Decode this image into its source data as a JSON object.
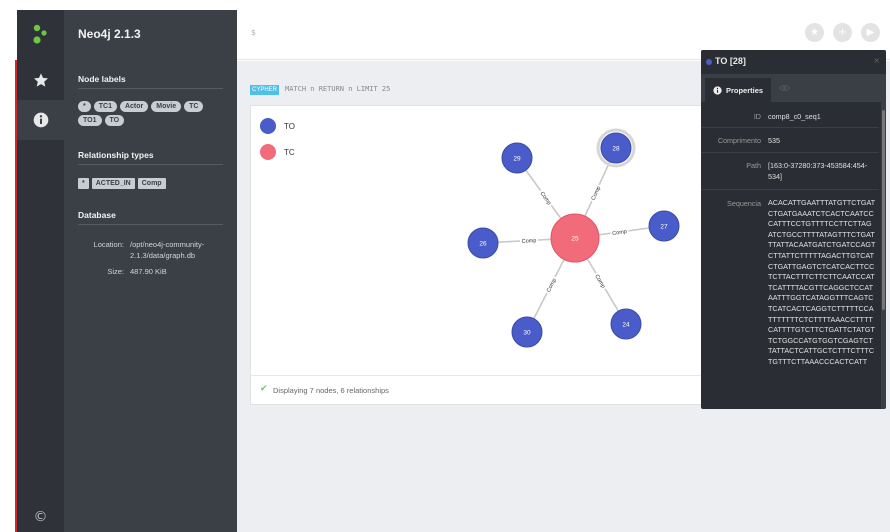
{
  "app": {
    "title": "Neo4j 2.1.3"
  },
  "topbar": {
    "prompt": "$"
  },
  "drawer": {
    "node_labels_heading": "Node labels",
    "node_labels": [
      "*",
      "TC1",
      "Actor",
      "Movie",
      "TC",
      "TO1",
      "TO"
    ],
    "rel_types_heading": "Relationship types",
    "rel_types": [
      "*",
      "ACTED_IN",
      "Comp"
    ],
    "database_heading": "Database",
    "location_label": "Location:",
    "location_value": "/opt/neo4j-community-2.1.3/data/graph.db",
    "size_label": "Size:",
    "size_value": "487.90 KiB"
  },
  "query": {
    "badge": "CYPHER",
    "text": "MATCH n RETURN n LIMIT 25"
  },
  "legend": [
    {
      "label": "TO",
      "color": "#4a5cc9"
    },
    {
      "label": "TC",
      "color": "#f26b7a"
    }
  ],
  "graph": {
    "rel_label": "Comp",
    "center": {
      "id": "25",
      "color": "#f26b7a"
    },
    "nodes": [
      {
        "id": "29",
        "color": "#4a5cc9"
      },
      {
        "id": "28",
        "color": "#4a5cc9"
      },
      {
        "id": "27",
        "color": "#4a5cc9"
      },
      {
        "id": "26",
        "color": "#4a5cc9"
      },
      {
        "id": "30",
        "color": "#4a5cc9"
      },
      {
        "id": "24",
        "color": "#4a5cc9"
      }
    ]
  },
  "status": {
    "text": "Displaying 7 nodes, 6 relationships"
  },
  "panel": {
    "title": "TO [28]",
    "tab_properties": "Properties",
    "close": "×",
    "properties": [
      {
        "key": "ID",
        "value": "comp8_c0_seq1"
      },
      {
        "key": "Comprimento",
        "value": "535"
      },
      {
        "key": "Path",
        "value": "[163:0-37280:373-453584:454-534]"
      },
      {
        "key": "Sequencia",
        "value": "ACACATTGAATTTATGTTCTGATCTGATGAAATCTCACTCAATCCCATTTCCTGTTTTCCTTCTTAGATCTGCCTTTTATAGTTTCTGATTTATTACAATGATCTGATCCAGTCTTATTCTTTTTAGACTTGTCATCTGATTGAGTCTCATCACTTCCTCTTACTTTCTTCTTCAATCCATTCATTTTACGTTCAGGCTCCATAATTTGGTCATAGGTTTCAGTCTCATCACTCAGGTCTTTTTCCATTTTTTTCTCTTTTAAACCTTTTCATTTTGTCTTCTGATTCTATGTTCTGGCCATGTGGTCGAGTCTTATTACTCATTGCTCTTTCTTTCTGTTTCTTAAACCCACTCATT"
      }
    ]
  }
}
